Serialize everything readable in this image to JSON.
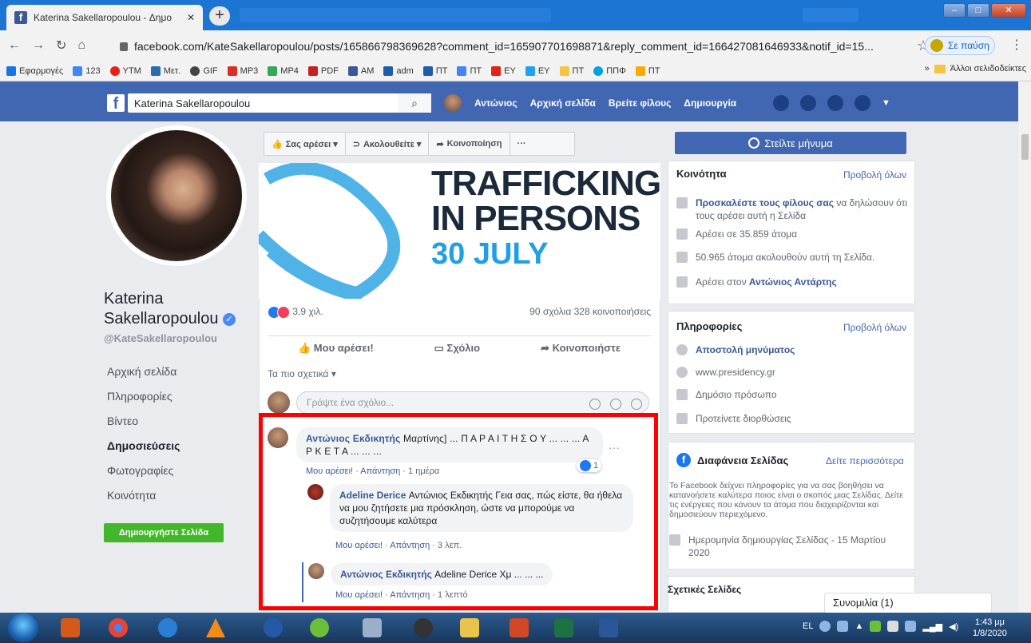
{
  "browser": {
    "tab_title": "Katerina Sakellaropoulou - Δημο",
    "url": "facebook.com/KateSakellaropoulou/posts/165866798369628?comment_id=165907701698871&reply_comment_id=166427081646933&notif_id=15...",
    "pause_label": "Σε παύση",
    "bookmarks": [
      "Εφαρμογές",
      "123",
      "YTM",
      "Μετ.",
      "GIF",
      "MP3",
      "MP4",
      "PDF",
      "AM",
      "adm",
      "ΠΤ",
      "ΠΤ",
      "EY",
      "EY",
      "ΠΤ",
      "ΠΠΦ",
      "ΠΤ"
    ],
    "bookmarks_more": "»",
    "other_bookmarks": "Άλλοι σελιδοδείκτες"
  },
  "fb_header": {
    "search_value": "Katerina Sakellaropoulou",
    "user_name": "Αντώνιος",
    "nav": [
      "Αρχική σελίδα",
      "Βρείτε φίλους",
      "Δημιουργία"
    ]
  },
  "profile": {
    "name": "Katerina Sakellaropoulou",
    "handle": "@KateSakellaropoulou",
    "nav": [
      "Αρχική σελίδα",
      "Πληροφορίες",
      "Βίντεο",
      "Δημοσιεύσεις",
      "Φωτογραφίες",
      "Κοινότητα"
    ],
    "active_nav": "Δημοσιεύσεις",
    "create_page": "Δημιουργήστε Σελίδα"
  },
  "page_actions": [
    "Σας αρέσει ▾",
    "Ακολουθείτε ▾",
    "Κοινοποίηση",
    "···"
  ],
  "post": {
    "image_text": [
      "TRAFFICKING",
      "IN PERSONS",
      "30 JULY"
    ],
    "reactions_count": "3,9 χιλ.",
    "comments_shares": "90 σχόλια  328 κοινοποιήσεις",
    "like": "Μου αρέσει!",
    "comment": "Σχόλιο",
    "share": "Κοινοποιήστε",
    "sort_label": "Τα πιο σχετικά ▾",
    "comment_placeholder": "Γράψτε ένα σχόλιο...",
    "comments": [
      {
        "author": "Αντώνιος Εκδικητής",
        "text": " Μαρτίνης] ... Π Α Ρ Α Ι Τ Η Σ Ο Υ ... ... ... Α Ρ Κ Ε Τ Α ... ... ...",
        "like": "Μου αρέσει!",
        "reply": "Απάντηση",
        "time": "1 ημέρα",
        "reactions": "1"
      },
      {
        "author": "Adeline Derice",
        "text": " Αντώνιος Εκδικητής Γεια σας, πώς είστε, θα ήθελα να μου ζητήσετε μια πρόσκληση, ώστε να μπορούμε να συζητήσουμε καλύτερα",
        "like": "Μου αρέσει!",
        "reply": "Απάντηση",
        "time": "3 λεπ."
      },
      {
        "author": "Αντώνιος Εκδικητής",
        "text": " Adeline Derice Χμ ... ... ...",
        "like": "Μου αρέσει!",
        "reply": "Απάντηση",
        "time": "1 λεπτό"
      }
    ]
  },
  "right": {
    "message_button": "Στείλτε μήνυμα",
    "community": {
      "title": "Κοινότητα",
      "see_all": "Προβολή όλων",
      "invite_link": "Προσκαλέστε τους φίλους σας",
      "invite_rest": " να δηλώσουν ότι τους αρέσει αυτή η Σελίδα",
      "likes": "Αρέσει σε 35.859 άτομα",
      "follows": "50.965 άτομα ακολουθούν αυτή τη Σελίδα.",
      "liked_by_prefix": "Αρέσει στον ",
      "liked_by": "Αντώνιος Αντάρτης"
    },
    "info": {
      "title": "Πληροφορίες",
      "see_all": "Προβολή όλων",
      "send_message": "Αποστολή μηνύματος",
      "website": "www.presidency.gr",
      "category": "Δημόσιο πρόσωπο",
      "suggest": "Προτείνετε διορθώσεις"
    },
    "transparency": {
      "title": "Διαφάνεια Σελίδας",
      "see_more": "Δείτε περισσότερα",
      "desc": "Το Facebook δείχνει πληροφορίες για να σας βοηθήσει να κατανοήσετε καλύτερα ποιος είναι ο σκοπός μιας Σελίδας. Δείτε τις ενέργειες που κάνουν τα άτομα που διαχειρίζονται και δημοσιεύουν περιεχόμενο.",
      "created": "Ημερομηνία δημιουργίας Σελίδας - 15 Μαρτίου 2020"
    },
    "related_title": "Σχετικές Σελίδες",
    "chat": "Συνομιλία (1)"
  },
  "taskbar": {
    "lang": "EL",
    "time": "1:43 μμ",
    "date": "1/8/2020"
  },
  "colors": {
    "fb_blue": "#4267b2",
    "link": "#385898",
    "highlight": "#ff0000",
    "create_green": "#42b72a"
  }
}
